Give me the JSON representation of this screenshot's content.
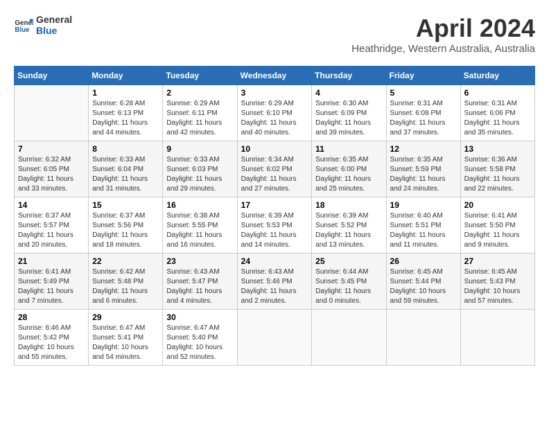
{
  "header": {
    "logo_line1": "General",
    "logo_line2": "Blue",
    "month_title": "April 2024",
    "subtitle": "Heathridge, Western Australia, Australia"
  },
  "days_of_week": [
    "Sunday",
    "Monday",
    "Tuesday",
    "Wednesday",
    "Thursday",
    "Friday",
    "Saturday"
  ],
  "weeks": [
    [
      {
        "day": "",
        "sunrise": "",
        "sunset": "",
        "daylight": ""
      },
      {
        "day": "1",
        "sunrise": "Sunrise: 6:28 AM",
        "sunset": "Sunset: 6:13 PM",
        "daylight": "Daylight: 11 hours and 44 minutes."
      },
      {
        "day": "2",
        "sunrise": "Sunrise: 6:29 AM",
        "sunset": "Sunset: 6:11 PM",
        "daylight": "Daylight: 11 hours and 42 minutes."
      },
      {
        "day": "3",
        "sunrise": "Sunrise: 6:29 AM",
        "sunset": "Sunset: 6:10 PM",
        "daylight": "Daylight: 11 hours and 40 minutes."
      },
      {
        "day": "4",
        "sunrise": "Sunrise: 6:30 AM",
        "sunset": "Sunset: 6:09 PM",
        "daylight": "Daylight: 11 hours and 39 minutes."
      },
      {
        "day": "5",
        "sunrise": "Sunrise: 6:31 AM",
        "sunset": "Sunset: 6:08 PM",
        "daylight": "Daylight: 11 hours and 37 minutes."
      },
      {
        "day": "6",
        "sunrise": "Sunrise: 6:31 AM",
        "sunset": "Sunset: 6:06 PM",
        "daylight": "Daylight: 11 hours and 35 minutes."
      }
    ],
    [
      {
        "day": "7",
        "sunrise": "Sunrise: 6:32 AM",
        "sunset": "Sunset: 6:05 PM",
        "daylight": "Daylight: 11 hours and 33 minutes."
      },
      {
        "day": "8",
        "sunrise": "Sunrise: 6:33 AM",
        "sunset": "Sunset: 6:04 PM",
        "daylight": "Daylight: 11 hours and 31 minutes."
      },
      {
        "day": "9",
        "sunrise": "Sunrise: 6:33 AM",
        "sunset": "Sunset: 6:03 PM",
        "daylight": "Daylight: 11 hours and 29 minutes."
      },
      {
        "day": "10",
        "sunrise": "Sunrise: 6:34 AM",
        "sunset": "Sunset: 6:02 PM",
        "daylight": "Daylight: 11 hours and 27 minutes."
      },
      {
        "day": "11",
        "sunrise": "Sunrise: 6:35 AM",
        "sunset": "Sunset: 6:00 PM",
        "daylight": "Daylight: 11 hours and 25 minutes."
      },
      {
        "day": "12",
        "sunrise": "Sunrise: 6:35 AM",
        "sunset": "Sunset: 5:59 PM",
        "daylight": "Daylight: 11 hours and 24 minutes."
      },
      {
        "day": "13",
        "sunrise": "Sunrise: 6:36 AM",
        "sunset": "Sunset: 5:58 PM",
        "daylight": "Daylight: 11 hours and 22 minutes."
      }
    ],
    [
      {
        "day": "14",
        "sunrise": "Sunrise: 6:37 AM",
        "sunset": "Sunset: 5:57 PM",
        "daylight": "Daylight: 11 hours and 20 minutes."
      },
      {
        "day": "15",
        "sunrise": "Sunrise: 6:37 AM",
        "sunset": "Sunset: 5:56 PM",
        "daylight": "Daylight: 11 hours and 18 minutes."
      },
      {
        "day": "16",
        "sunrise": "Sunrise: 6:38 AM",
        "sunset": "Sunset: 5:55 PM",
        "daylight": "Daylight: 11 hours and 16 minutes."
      },
      {
        "day": "17",
        "sunrise": "Sunrise: 6:39 AM",
        "sunset": "Sunset: 5:53 PM",
        "daylight": "Daylight: 11 hours and 14 minutes."
      },
      {
        "day": "18",
        "sunrise": "Sunrise: 6:39 AM",
        "sunset": "Sunset: 5:52 PM",
        "daylight": "Daylight: 11 hours and 13 minutes."
      },
      {
        "day": "19",
        "sunrise": "Sunrise: 6:40 AM",
        "sunset": "Sunset: 5:51 PM",
        "daylight": "Daylight: 11 hours and 11 minutes."
      },
      {
        "day": "20",
        "sunrise": "Sunrise: 6:41 AM",
        "sunset": "Sunset: 5:50 PM",
        "daylight": "Daylight: 11 hours and 9 minutes."
      }
    ],
    [
      {
        "day": "21",
        "sunrise": "Sunrise: 6:41 AM",
        "sunset": "Sunset: 5:49 PM",
        "daylight": "Daylight: 11 hours and 7 minutes."
      },
      {
        "day": "22",
        "sunrise": "Sunrise: 6:42 AM",
        "sunset": "Sunset: 5:48 PM",
        "daylight": "Daylight: 11 hours and 6 minutes."
      },
      {
        "day": "23",
        "sunrise": "Sunrise: 6:43 AM",
        "sunset": "Sunset: 5:47 PM",
        "daylight": "Daylight: 11 hours and 4 minutes."
      },
      {
        "day": "24",
        "sunrise": "Sunrise: 6:43 AM",
        "sunset": "Sunset: 5:46 PM",
        "daylight": "Daylight: 11 hours and 2 minutes."
      },
      {
        "day": "25",
        "sunrise": "Sunrise: 6:44 AM",
        "sunset": "Sunset: 5:45 PM",
        "daylight": "Daylight: 11 hours and 0 minutes."
      },
      {
        "day": "26",
        "sunrise": "Sunrise: 6:45 AM",
        "sunset": "Sunset: 5:44 PM",
        "daylight": "Daylight: 10 hours and 59 minutes."
      },
      {
        "day": "27",
        "sunrise": "Sunrise: 6:45 AM",
        "sunset": "Sunset: 5:43 PM",
        "daylight": "Daylight: 10 hours and 57 minutes."
      }
    ],
    [
      {
        "day": "28",
        "sunrise": "Sunrise: 6:46 AM",
        "sunset": "Sunset: 5:42 PM",
        "daylight": "Daylight: 10 hours and 55 minutes."
      },
      {
        "day": "29",
        "sunrise": "Sunrise: 6:47 AM",
        "sunset": "Sunset: 5:41 PM",
        "daylight": "Daylight: 10 hours and 54 minutes."
      },
      {
        "day": "30",
        "sunrise": "Sunrise: 6:47 AM",
        "sunset": "Sunset: 5:40 PM",
        "daylight": "Daylight: 10 hours and 52 minutes."
      },
      {
        "day": "",
        "sunrise": "",
        "sunset": "",
        "daylight": ""
      },
      {
        "day": "",
        "sunrise": "",
        "sunset": "",
        "daylight": ""
      },
      {
        "day": "",
        "sunrise": "",
        "sunset": "",
        "daylight": ""
      },
      {
        "day": "",
        "sunrise": "",
        "sunset": "",
        "daylight": ""
      }
    ]
  ]
}
